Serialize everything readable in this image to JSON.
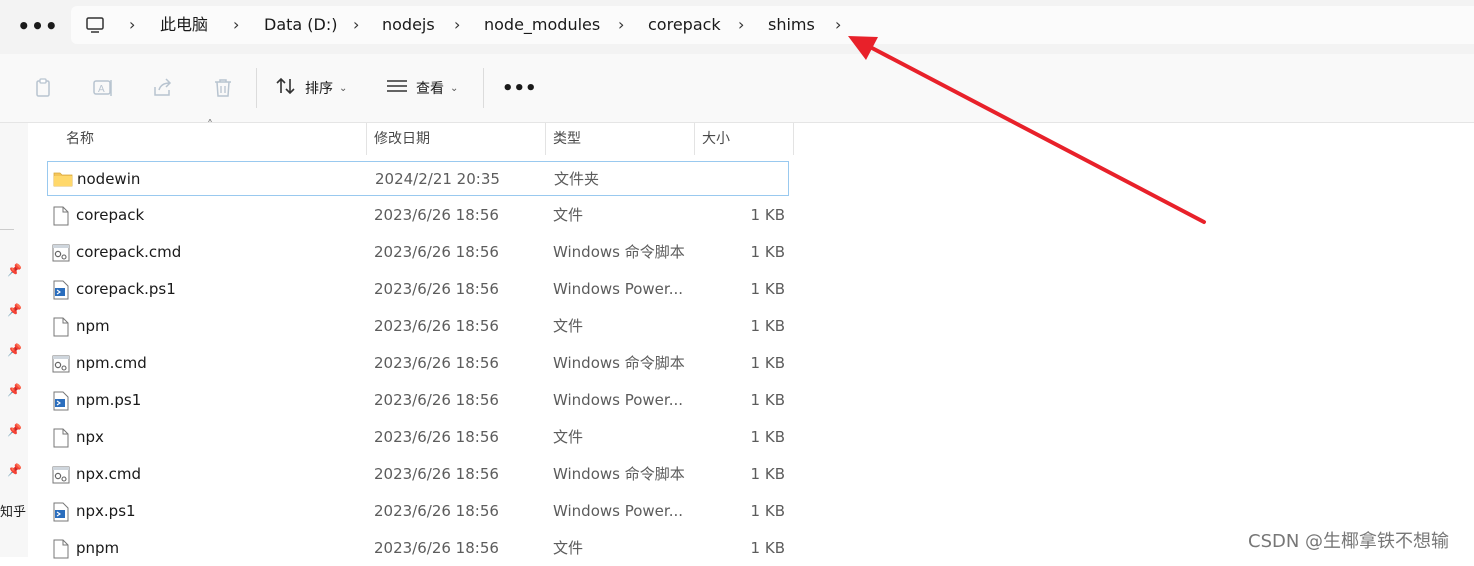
{
  "topbar": {
    "more": "•••",
    "breadcrumb": [
      {
        "label": "此电脑"
      },
      {
        "label": "Data (D:)"
      },
      {
        "label": "nodejs"
      },
      {
        "label": "node_modules"
      },
      {
        "label": "corepack"
      },
      {
        "label": "shims"
      }
    ]
  },
  "toolbar": {
    "sort_label": "排序",
    "view_label": "查看",
    "more": "•••"
  },
  "columns": {
    "name": "名称",
    "date": "修改日期",
    "type": "类型",
    "size": "大小"
  },
  "files": [
    {
      "name": "nodewin",
      "date": "2024/2/21 20:35",
      "type": "文件夹",
      "size": "",
      "icon": "folder-icon"
    },
    {
      "name": "corepack",
      "date": "2023/6/26 18:56",
      "type": "文件",
      "size": "1 KB",
      "icon": "file-icon"
    },
    {
      "name": "corepack.cmd",
      "date": "2023/6/26 18:56",
      "type": "Windows 命令脚本",
      "size": "1 KB",
      "icon": "cmd-file-icon"
    },
    {
      "name": "corepack.ps1",
      "date": "2023/6/26 18:56",
      "type": "Windows Power...",
      "size": "1 KB",
      "icon": "powershell-file-icon"
    },
    {
      "name": "npm",
      "date": "2023/6/26 18:56",
      "type": "文件",
      "size": "1 KB",
      "icon": "file-icon"
    },
    {
      "name": "npm.cmd",
      "date": "2023/6/26 18:56",
      "type": "Windows 命令脚本",
      "size": "1 KB",
      "icon": "cmd-file-icon"
    },
    {
      "name": "npm.ps1",
      "date": "2023/6/26 18:56",
      "type": "Windows Power...",
      "size": "1 KB",
      "icon": "powershell-file-icon"
    },
    {
      "name": "npx",
      "date": "2023/6/26 18:56",
      "type": "文件",
      "size": "1 KB",
      "icon": "file-icon"
    },
    {
      "name": "npx.cmd",
      "date": "2023/6/26 18:56",
      "type": "Windows 命令脚本",
      "size": "1 KB",
      "icon": "cmd-file-icon"
    },
    {
      "name": "npx.ps1",
      "date": "2023/6/26 18:56",
      "type": "Windows Power...",
      "size": "1 KB",
      "icon": "powershell-file-icon"
    },
    {
      "name": "pnpm",
      "date": "2023/6/26 18:56",
      "type": "文件",
      "size": "1 KB",
      "icon": "file-icon"
    }
  ],
  "sidebar": {
    "partial_text": "知乎"
  },
  "watermark": "CSDN @生椰拿铁不想输",
  "colors": {
    "arrow": "#e8212a",
    "selection_border": "#99c9ef",
    "folder": "#f4c55a"
  }
}
